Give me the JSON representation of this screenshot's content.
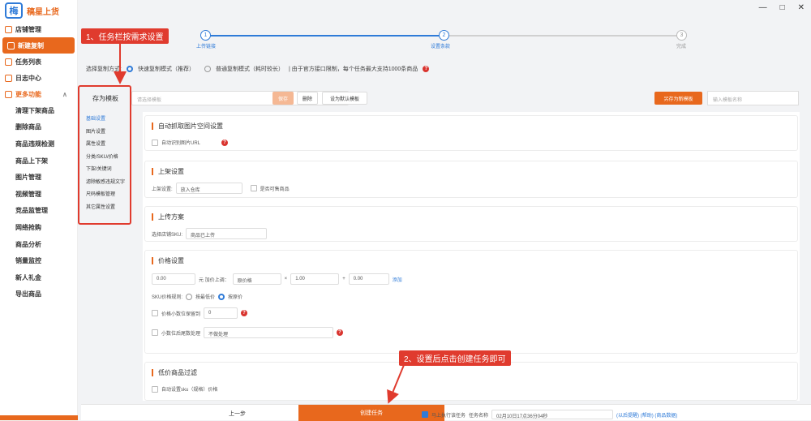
{
  "app": {
    "logo_mark": "梅",
    "title": "稿星上货"
  },
  "window": {
    "minimize": "—",
    "maximize": "□",
    "close": "✕"
  },
  "sidebar": {
    "items": [
      {
        "label": "店铺管理"
      },
      {
        "label": "新建复制"
      },
      {
        "label": "任务列表"
      },
      {
        "label": "日志中心"
      }
    ],
    "section": {
      "label": "更多功能",
      "arrow": "∧"
    },
    "subitems": [
      "清理下架商品",
      "删除商品",
      "商品违规检测",
      "商品上下架",
      "图片管理",
      "视频管理",
      "竞品监管理",
      "网络抢购",
      "商品分析",
      "销量监控",
      "新人礼金",
      "导出商品"
    ]
  },
  "steps": [
    {
      "num": "1",
      "label": "上传链接"
    },
    {
      "num": "2",
      "label": "设置条款"
    },
    {
      "num": "3",
      "label": "完成"
    }
  ],
  "mode": {
    "label": "选择复制方式:",
    "option1": "快速复制模式（推荐）",
    "option2": "普通复制模式（耗时较长）",
    "note": "| 由于官方接口限制，每个任务最大支持1000条商品"
  },
  "template": {
    "label": "存为模板",
    "placeholder": "请选择模板",
    "btn_save": "保存",
    "btn_delete": "删除",
    "btn_default": "设为默认模板",
    "btn_save_as": "另存为新模板",
    "search_placeholder": "输入模板名称"
  },
  "menu": [
    "基础设置",
    "图片设置",
    "属性设置",
    "分类/SKU/价格",
    "下架/关键词",
    "滤除敏感违规文字",
    "尺码模板管理",
    "其它属性设置"
  ],
  "cards": {
    "auto_fetch": {
      "title": "自动抓取图片空间设置",
      "checkbox": "自动识别图片URL"
    },
    "upload": {
      "title": "上架设置",
      "label": "上架设置:",
      "value": "放入仓库",
      "checkbox": "是否可售商品"
    },
    "shelf": {
      "title": "上传方案",
      "label": "选择店铺SKU:",
      "value": "商品已上传"
    },
    "price": {
      "title": "价格设置",
      "base": "0.00",
      "op1_label": "元 加价上调：",
      "op1_select": "原价格",
      "times": "×",
      "mult": "1.00",
      "plus": "+",
      "add": "0.00",
      "link": "添加",
      "rule_label": "SKU价格规则:",
      "rule_opt1": "按最低价",
      "rule_opt2": "按原价",
      "round_label": "价格小数位保留到",
      "round_value": "0",
      "tail_label": "小数位后尾数处理",
      "tail_value": "不做处理"
    },
    "after": {
      "title": "低价商品过滤",
      "checkbox": "自动设置sku（规格）价格"
    }
  },
  "bottom": {
    "prev": "上一步",
    "create": "创建任务",
    "task_check": "马上执行该任务",
    "task_label": "任务名称",
    "task_value": "02月10日17点36分04秒",
    "links": "(以后提醒) (帮助) (商品数据)"
  },
  "annotations": {
    "tag1": "1、任务栏按需求设置",
    "tag2": "2、设置后点击创建任务即可"
  }
}
